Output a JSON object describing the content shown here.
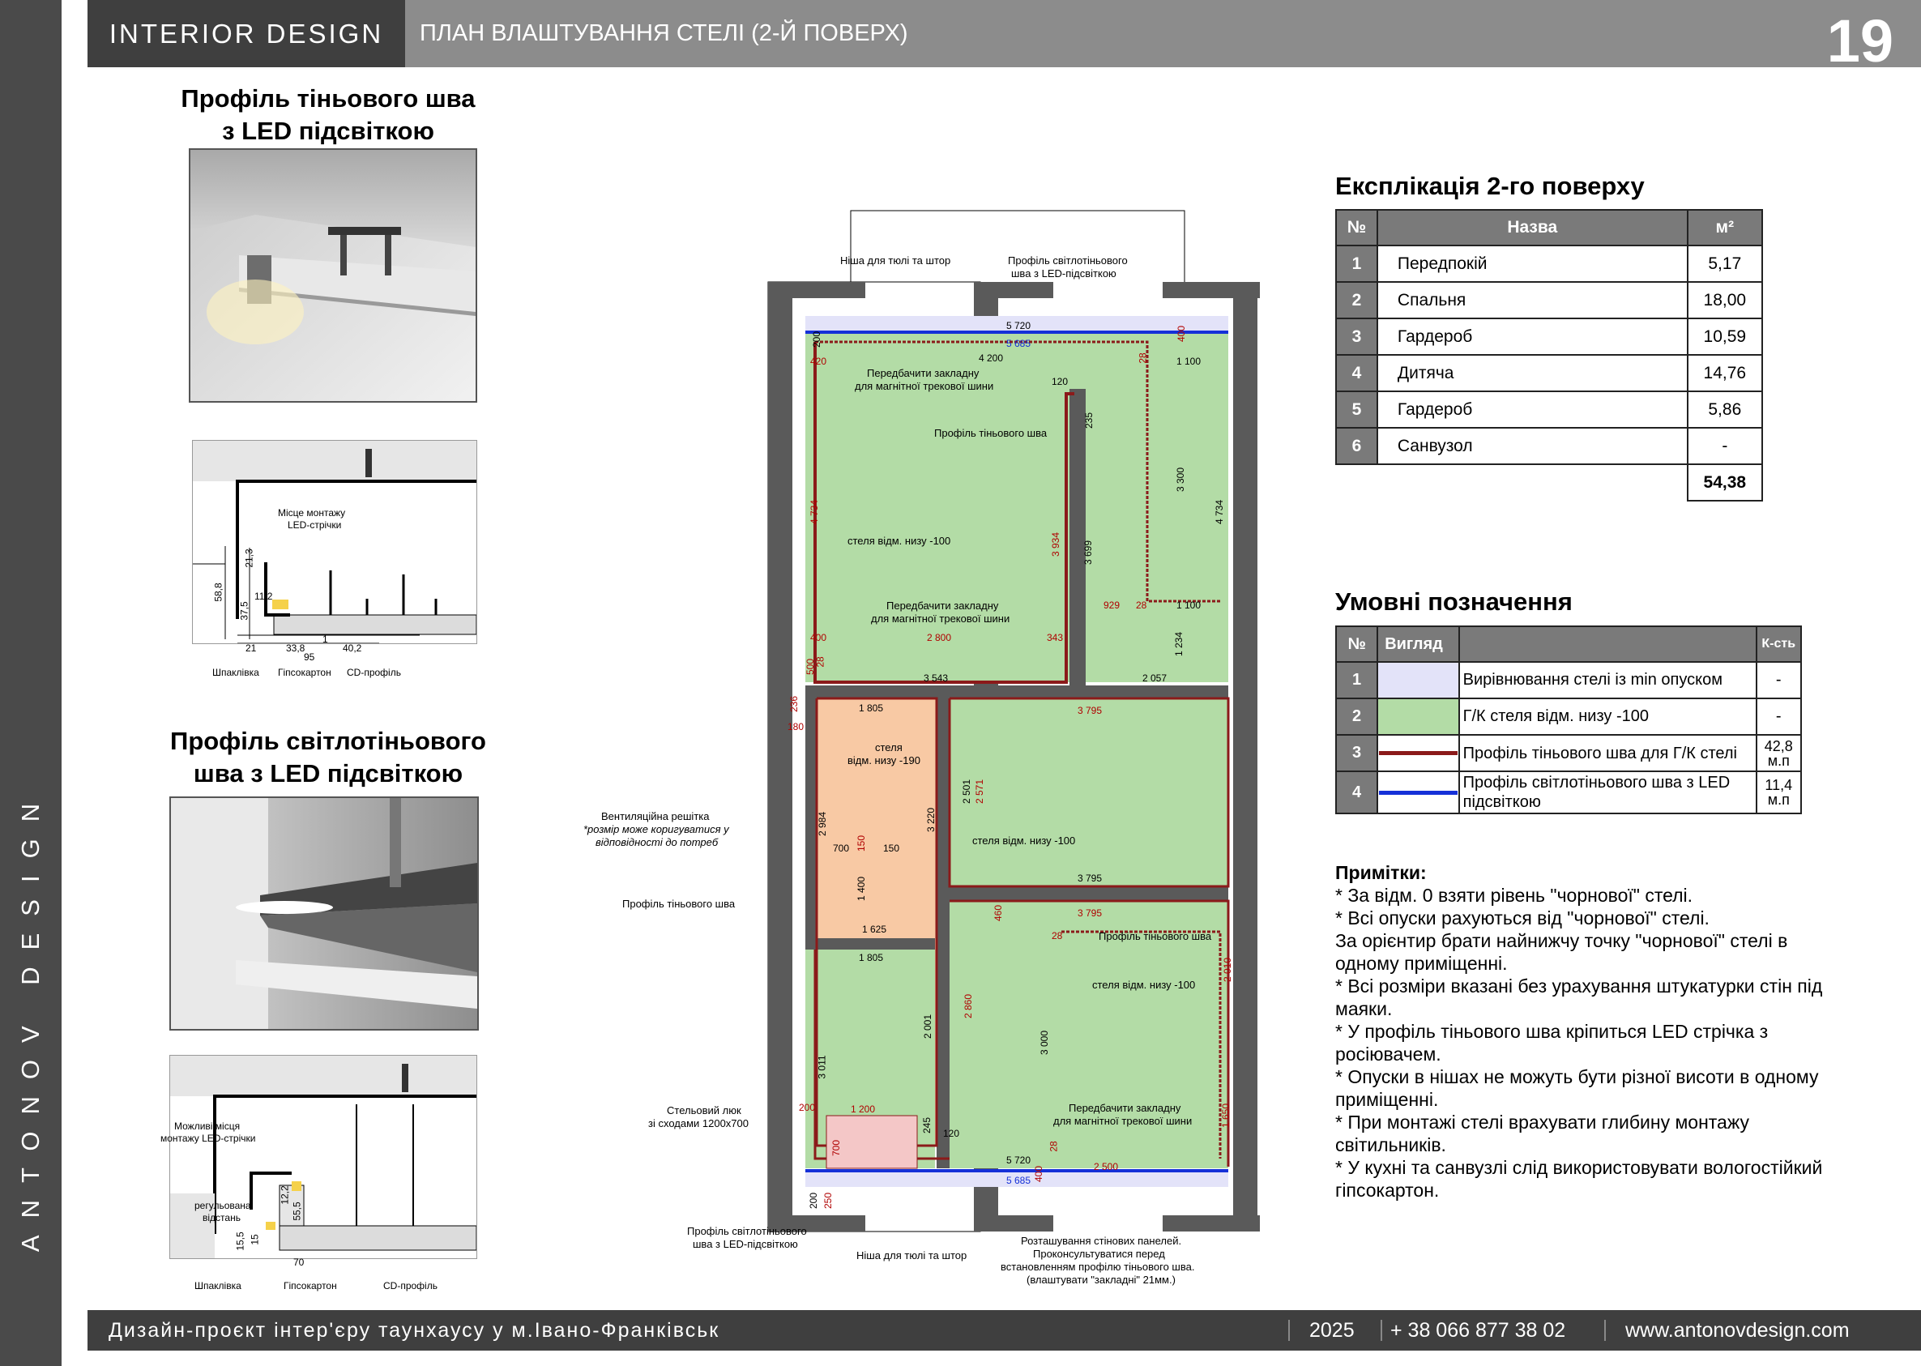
{
  "side_label": "ANTONOV DESIGN",
  "header": {
    "brand": "INTERIOR  DESIGN",
    "title": "ПЛАН ВЛАШТУВАННЯ СТЕЛІ (2-Й ПОВЕРХ)",
    "page": "19"
  },
  "left": {
    "shadow_title_1": "Профіль тіньового шва",
    "shadow_title_2": "з LED підсвіткою",
    "light_title_1": "Профіль світлотіньового",
    "light_title_2": "шва з LED підсвіткою",
    "detail1": {
      "mount_1": "Місце монтажу",
      "mount_2": "LED-стрічки",
      "d213": "21,3",
      "d588": "58,8",
      "d375": "37,5",
      "d112": "11,2",
      "d21": "21",
      "d338": "33,8",
      "d402": "40,2",
      "d1": "1",
      "d95": "95",
      "plaster": "Шпаклівка",
      "gypsum": "Гіпсокартон",
      "cd": "CD-профіль"
    },
    "detail2": {
      "possible_1": "Можливі місця",
      "possible_2": "монтажу LED-стрічки",
      "adj_1": "регульована",
      "adj_2": "відстань",
      "d122": "12,2",
      "d555": "55,5",
      "d155": "15,5",
      "d15": "15",
      "d70": "70",
      "plaster": "Шпаклівка",
      "gypsum": "Гіпсокартон",
      "cd": "CD-профіль"
    }
  },
  "explication": {
    "title": "Експлікація 2-го поверху",
    "headers": [
      "№",
      "Назва",
      "м²"
    ],
    "rows": [
      {
        "n": "1",
        "name": "Передпокій",
        "area": "5,17"
      },
      {
        "n": "2",
        "name": "Спальня",
        "area": "18,00"
      },
      {
        "n": "3",
        "name": "Гардероб",
        "area": "10,59"
      },
      {
        "n": "4",
        "name": "Дитяча",
        "area": "14,76"
      },
      {
        "n": "5",
        "name": "Гардероб",
        "area": "5,86"
      },
      {
        "n": "6",
        "name": "Санвузол",
        "area": "-"
      }
    ],
    "total": "54,38"
  },
  "legend": {
    "title": "Умовні позначення",
    "headers": [
      "№",
      "Вигляд",
      "",
      "К-сть"
    ],
    "rows": [
      {
        "n": "1",
        "swatch": "#e3e3f9",
        "line": "",
        "text": "Вирівнювання стелі із min опуском",
        "qty": "-"
      },
      {
        "n": "2",
        "swatch": "#b3dca6",
        "line": "",
        "text": "Г/К стеля відм. низу -100",
        "qty": "-"
      },
      {
        "n": "3",
        "swatch": "",
        "line": "#8b1a1a",
        "text": "Профіль тіньового шва для Г/К стелі",
        "qty": "42,8 м.п"
      },
      {
        "n": "4",
        "swatch": "",
        "line": "#1530d8",
        "text": "Профіль світлотіньового шва з LED підсвіткою",
        "qty": "11,4 м.п"
      }
    ]
  },
  "notes": {
    "title": "Примітки:",
    "lines": [
      "* За відм. 0 взяти рівень \"чорнової\" стелі.",
      "* Всі опуски рахуються від \"чорнової\" стелі.",
      "За орієнтир брати найнижчу точку \"чорнової\" стелі в одному приміщенні.",
      "* Всі розміри вказані без урахування штукатурки стін під маяки.",
      "* У профіль тіньового шва кріпиться LED стрічка з росіювачем.",
      "* Опуски в нішах не можуть бути різної висоти в одному приміщенні.",
      "* При монтажі стелі врахувати глибину монтажу світильників.",
      "* У кухні та санвузлі слід використовувати вологостійкий гіпсокартон."
    ]
  },
  "plan": {
    "niche_tulle_top": "Ніша для тюлі та штор",
    "light_profile_top_1": "Профіль світлотіньового",
    "light_profile_top_2": "шва з LED-підсвіткою",
    "embed1_1": "Передбачити закладну",
    "embed1_2": "для магнітної трекової шини",
    "shadow_label_top": "Профіль тіньового шва",
    "ceiling_bedroom": "стеля відм. низу -100",
    "embed2_1": "Передбачити закладну",
    "embed2_2": "для магнітної трекової шини",
    "hall_ceiling_1": "стеля",
    "hall_ceiling_2": "відм. низу -190",
    "ceiling_right_mid": "стеля відм. низу -100",
    "vent_1": "Вентиляційна решітка",
    "vent_2": "*розмір може коригуватися у",
    "vent_3": "відповідності до потреб",
    "shadow_label_left": "Профіль тіньового шва",
    "shadow_label_bottom": "Профіль тіньового шва",
    "ceiling_bottom_right": "стеля відм. низу -100",
    "embed3_1": "Передбачити закладну",
    "embed3_2": "для магнітної трекової шини",
    "hatch_1": "Стельовий люк",
    "hatch_2": "зі сходами 1200х700",
    "light_profile_bottom_1": "Профіль світлотіньового",
    "light_profile_bottom_2": "шва з LED-підсвіткою",
    "niche_tulle_bottom": "Ніша для тюлі та штор",
    "panels_1": "Розташування стінових панелей.",
    "panels_2": "Проконсультуватися перед",
    "panels_3": "встановленням профілю тіньового шва.",
    "panels_4": "(влаштувати \"закладні\" 21мм.)",
    "dims": {
      "d5720t": "5 720",
      "d5685t": "5 685",
      "d4200": "4 200",
      "d420": "420",
      "d200t": "200",
      "d400t": "400",
      "d28a": "28",
      "d1100a": "1 100",
      "d120t": "120",
      "d235": "235",
      "d4734l": "4 734",
      "d3934": "3 934",
      "d3699": "3 699",
      "d3300": "3 300",
      "d4734r": "4 734",
      "d929": "929",
      "d28b": "28",
      "d1100b": "1 100",
      "d400m": "400",
      "d2800": "2 800",
      "d343": "343",
      "d1234": "1 234",
      "d500": "500",
      "d28c": "28",
      "d3543": "3 543",
      "d2057": "2 057",
      "d236": "236",
      "d180": "180",
      "d1805a": "1 805",
      "d3795a": "3 795",
      "d2984": "2 984",
      "d3220": "3 220",
      "d2501": "2 501",
      "d2571": "2 571",
      "d700": "700",
      "d150a": "150",
      "d150b": "150",
      "d1400": "1 400",
      "d3795b": "3 795",
      "d1625": "1 625",
      "d460": "460",
      "d3795c": "3 795",
      "d28d": "28",
      "d1805b": "1 805",
      "d2001": "2 001",
      "d2860": "2 860",
      "d3000": "3 000",
      "d2010": "2 010",
      "d3011": "3 011",
      "d200m": "200",
      "d1200": "1 200",
      "d245": "245",
      "d120b": "120",
      "d1650": "1 650",
      "d700b": "700",
      "d28e": "28",
      "d5720b": "5 720",
      "d400b": "400",
      "d2500": "2 500",
      "d200b": "200",
      "d250": "250",
      "d5685b": "5 685"
    }
  },
  "footer": {
    "project": "Дизайн-проєкт інтер'єру таунхаусу у м.Івано-Франківськ",
    "year": "2025",
    "phone": "+ 38 066 877 38 02",
    "site": "www.antonovdesign.com"
  },
  "colors": {
    "green": "#b3dca6",
    "orange": "#f8c9a4",
    "lavender": "#e3e3f9",
    "wall": "#5a5a5a",
    "shadow_line": "#8b1a1a",
    "led_line": "#1530d8"
  }
}
